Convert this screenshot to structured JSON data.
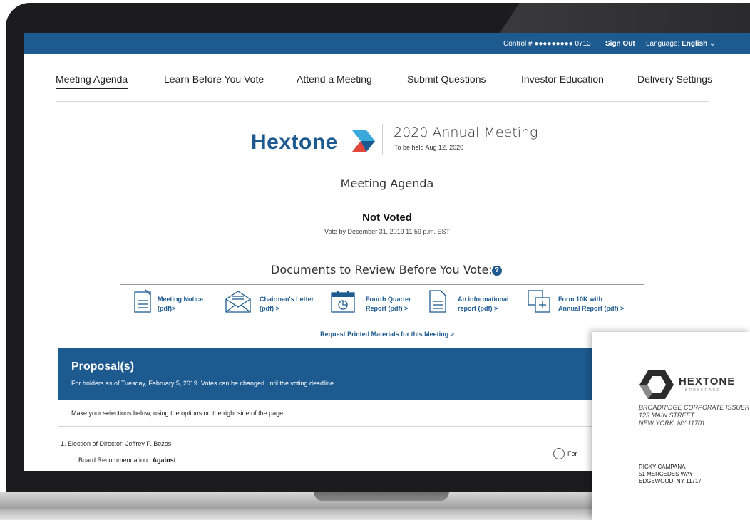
{
  "topbar": {
    "control_label": "Control # ●●●●●●●●● 0713",
    "sign_out": "Sign Out",
    "language_label": "Language:",
    "language_value": "English"
  },
  "nav": {
    "items": [
      {
        "label": "Meeting Agenda"
      },
      {
        "label": "Learn Before You Vote"
      },
      {
        "label": "Attend a Meeting"
      },
      {
        "label": "Submit Questions"
      },
      {
        "label": "Investor Education"
      },
      {
        "label": "Delivery Settings"
      }
    ]
  },
  "brand": {
    "name": "Hextone",
    "meeting_title": "2020 Annual Meeting",
    "meeting_date": "To be held Aug 12, 2020"
  },
  "page": {
    "title": "Meeting Agenda",
    "vote_status": "Not Voted",
    "vote_deadline": "Vote by December 31, 2019 11:59 p.m. EST"
  },
  "documents": {
    "heading": "Documents to Review Before You Vote:",
    "help": "?",
    "items": [
      {
        "line1": "Meeting Notice",
        "line2": "(pdf)>",
        "icon": "document-icon"
      },
      {
        "line1": "Chairman's Letter",
        "line2": "(pdf) >",
        "icon": "envelope-icon"
      },
      {
        "line1": "Fourth Quarter",
        "line2": "Report (pdf) >",
        "icon": "calendar-report-icon"
      },
      {
        "line1": "An informational",
        "line2": "report (pdf) >",
        "icon": "report-icon"
      },
      {
        "line1": "Form 10K with",
        "line2": "Annual Report (pdf) >",
        "icon": "form-icon"
      }
    ],
    "request_link": "Request Printed Materials for this Meeting >"
  },
  "proposals": {
    "title": "Proposal(s)",
    "subtitle": "For holders as of Tuesday, February 5, 2019. Votes can be changed until the voting deadline.",
    "instructions": "Make your selections below, using the options on the right side of the page.",
    "item_label": "1. Election of Director: Jeffrey P. Bezos",
    "board_rec_label": "Board Recommendation:",
    "board_rec_value": "Against",
    "option_for": "For"
  },
  "mail_card": {
    "brand": "HEXTONE",
    "brand_sub": "BROKERAGE",
    "sender_lines": [
      "BROADRIDGE CORPORATE ISSUER S",
      "123 MAIN STREET",
      "NEW YORK, NY 11701"
    ],
    "recipient_lines": [
      "RICKY CAMPANA",
      "51 MERCEDES WAY",
      "EDGEWOOD, NY 11717"
    ]
  },
  "colors": {
    "brand_blue": "#1d5a8f",
    "logo_red": "#e5473c",
    "logo_light_blue": "#39a9dc"
  }
}
